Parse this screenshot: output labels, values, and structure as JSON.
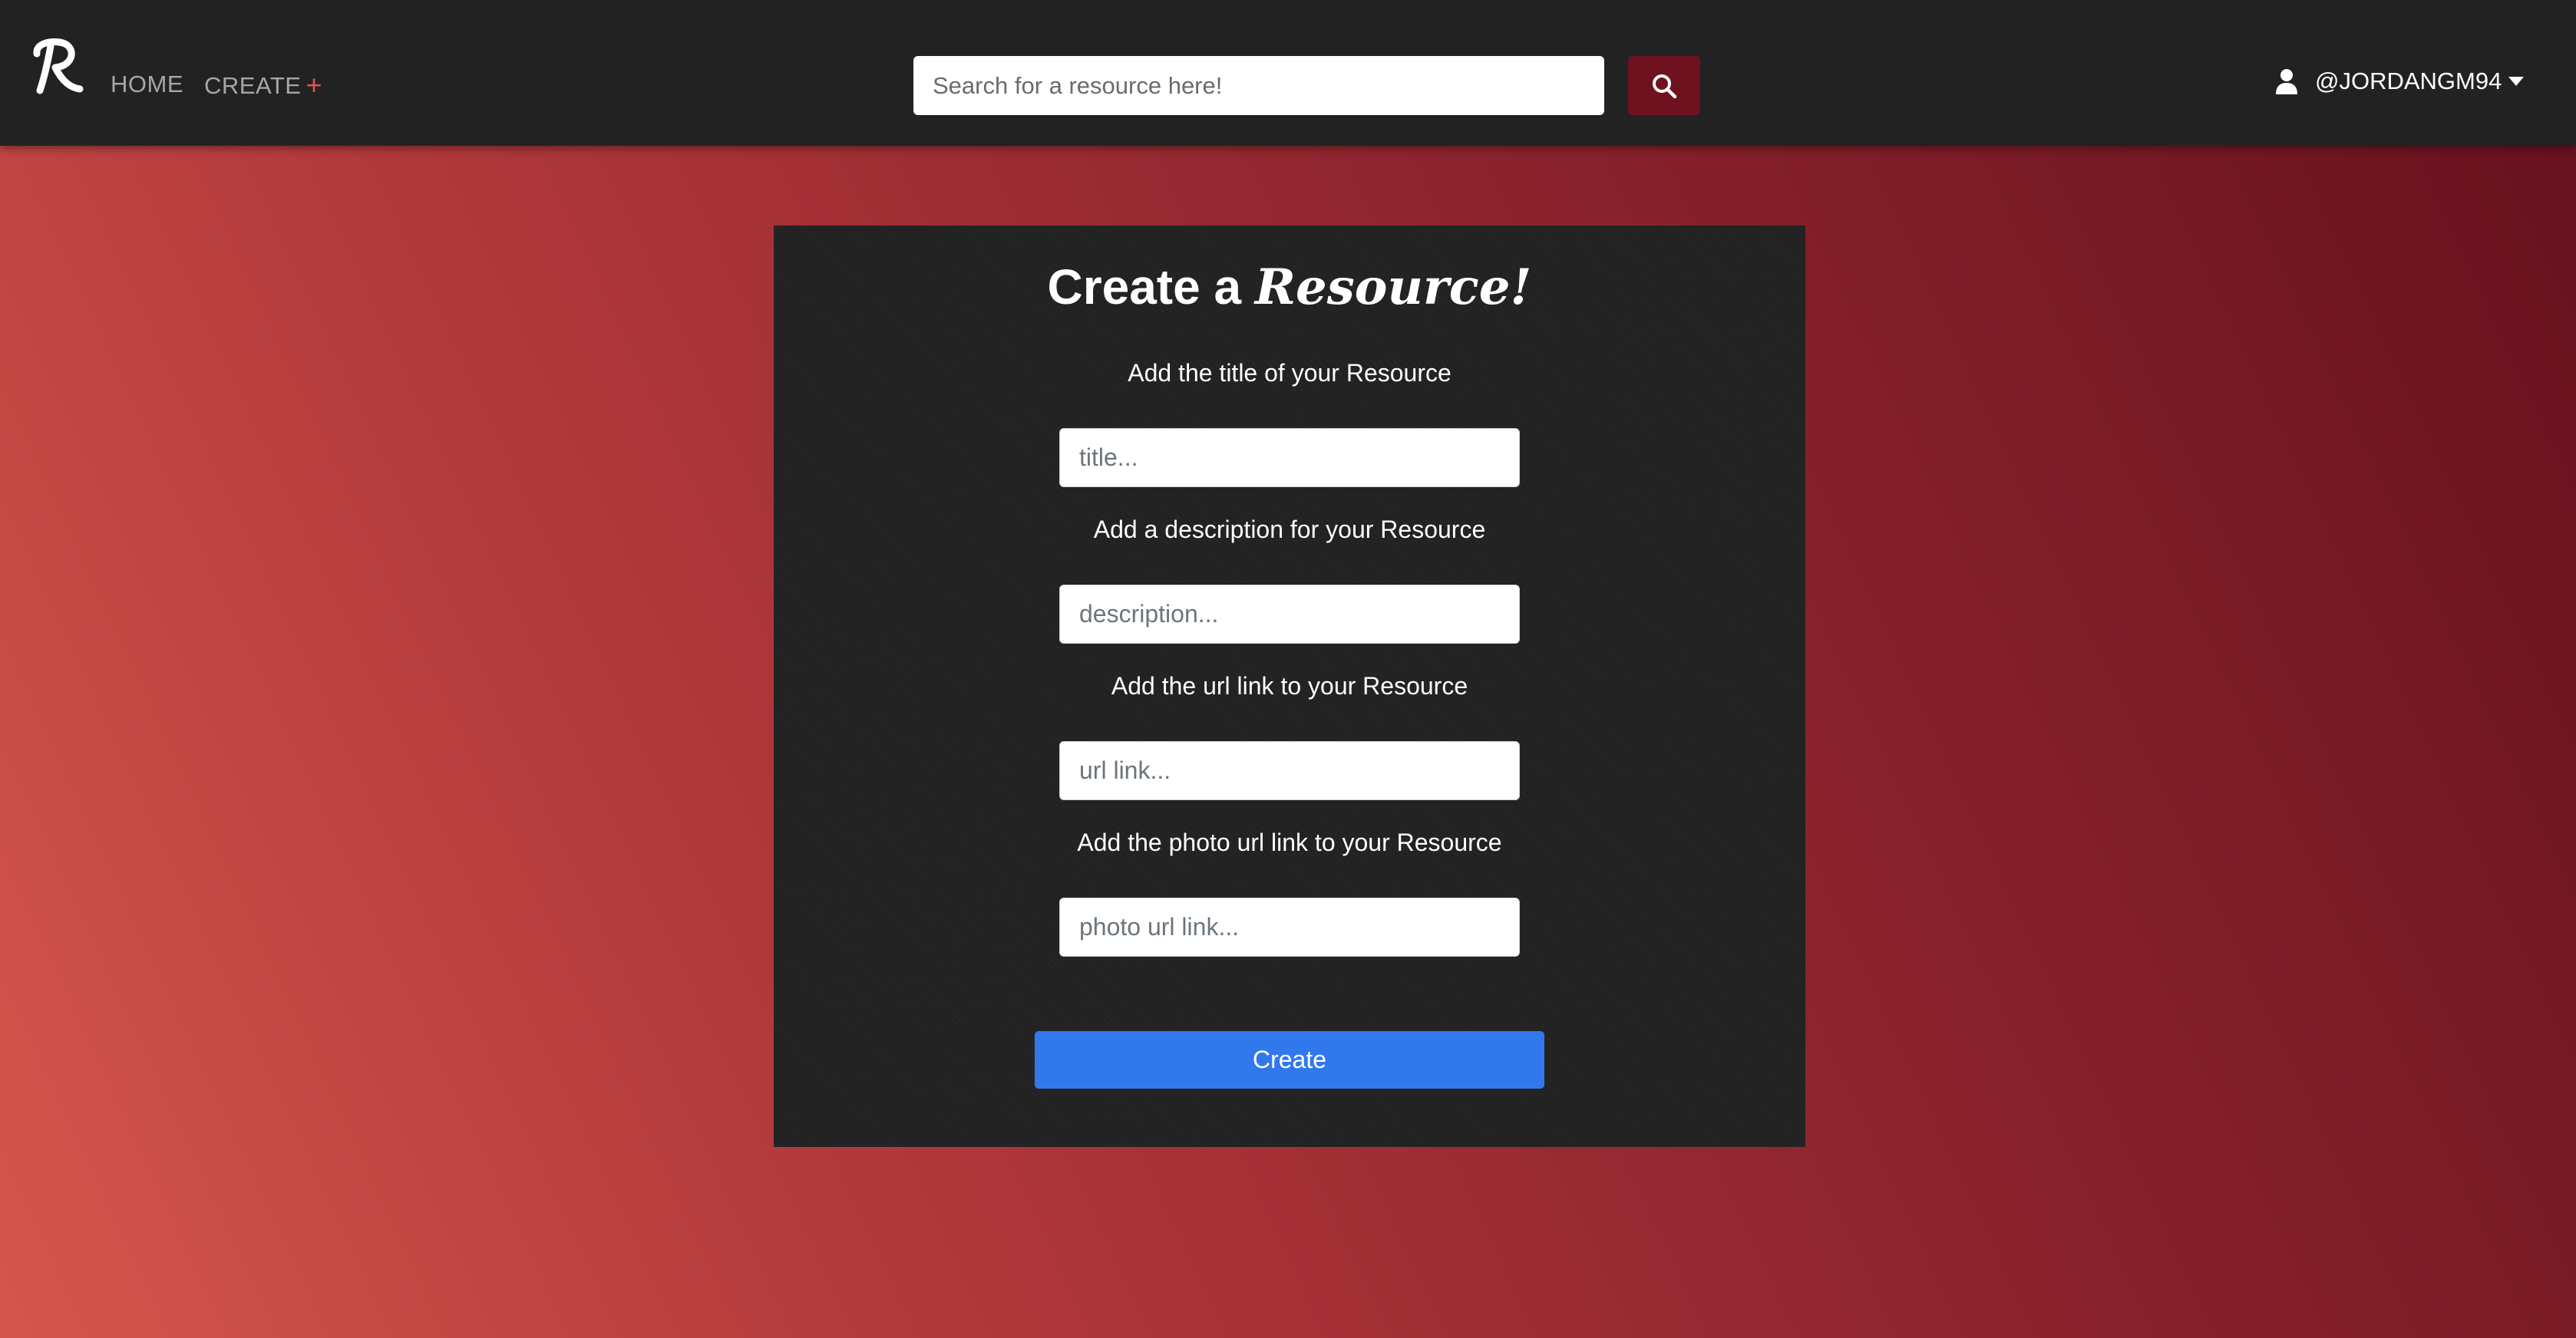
{
  "navbar": {
    "logo_letter": "R",
    "home_label": "HOME",
    "create_label": "CREATE",
    "create_plus": "+",
    "search": {
      "placeholder": "Search for a resource here!",
      "icon": "search-icon"
    },
    "user": {
      "icon": "user-icon",
      "username": "@JORDANGM94",
      "dropdown_icon": "caret-down-icon"
    }
  },
  "form": {
    "title_prefix": "Create a",
    "title_script": "Resource!",
    "fields": [
      {
        "label": "Add the title of your Resource",
        "placeholder": "title...",
        "value": ""
      },
      {
        "label": "Add a description for your Resource",
        "placeholder": "description...",
        "value": ""
      },
      {
        "label": "Add the url link to your Resource",
        "placeholder": "url link...",
        "value": ""
      },
      {
        "label": "Add the photo url link to your Resource",
        "placeholder": "photo url link...",
        "value": ""
      }
    ],
    "submit_label": "Create"
  },
  "colors": {
    "navbar_bg": "#222222",
    "panel_bg": "#222222",
    "search_button_bg": "#6e1220",
    "submit_bg": "#3278ed",
    "accent_plus": "#e35050",
    "gradient_start": "#d4564d",
    "gradient_end": "#65111e"
  }
}
